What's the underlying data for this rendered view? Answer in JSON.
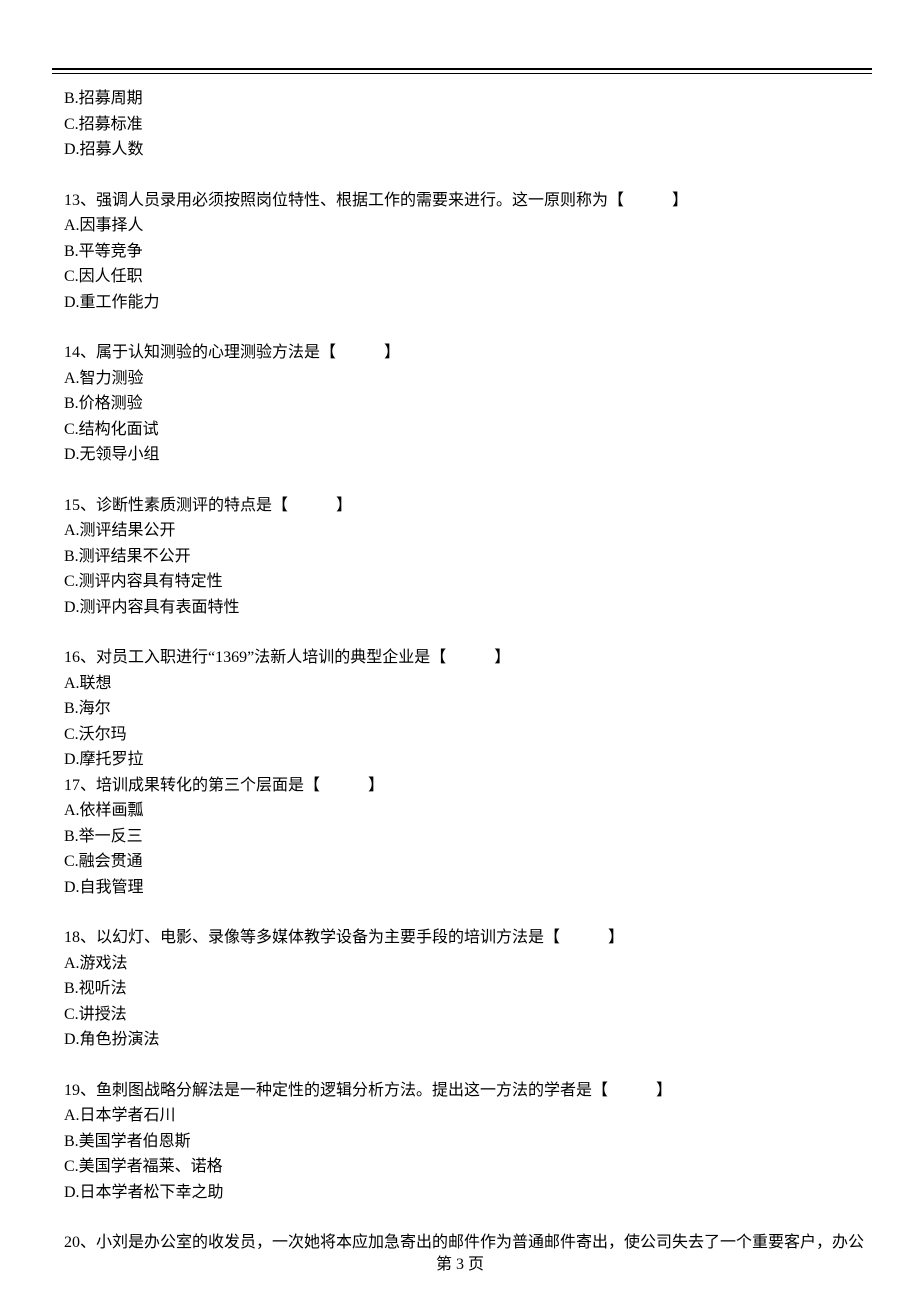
{
  "orphan_options": [
    "B.招募周期",
    "C.招募标准",
    "D.招募人数"
  ],
  "questions": [
    {
      "stem": "13、强调人员录用必须按照岗位特性、根据工作的需要来进行。这一原则称为【　　　】",
      "options": [
        "A.因事择人",
        "B.平等竞争",
        "C.因人任职",
        "D.重工作能力"
      ],
      "gap_after": true
    },
    {
      "stem": "14、属于认知测验的心理测验方法是【　　　】",
      "options": [
        "A.智力测验",
        "B.价格测验",
        "C.结构化面试",
        "D.无领导小组"
      ],
      "gap_after": true
    },
    {
      "stem": "15、诊断性素质测评的特点是【　　　】",
      "options": [
        "A.测评结果公开",
        "B.测评结果不公开",
        "C.测评内容具有特定性",
        "D.测评内容具有表面特性"
      ],
      "gap_after": true
    },
    {
      "stem": "16、对员工入职进行“1369”法新人培训的典型企业是【　　　】",
      "options": [
        "A.联想",
        "B.海尔",
        "C.沃尔玛",
        "D.摩托罗拉"
      ],
      "gap_after": false
    },
    {
      "stem": "17、培训成果转化的第三个层面是【　　　】",
      "options": [
        "A.依样画瓢",
        "B.举一反三",
        "C.融会贯通",
        "D.自我管理"
      ],
      "gap_after": true
    },
    {
      "stem": "18、以幻灯、电影、录像等多媒体教学设备为主要手段的培训方法是【　　　】",
      "options": [
        "A.游戏法",
        "B.视听法",
        "C.讲授法",
        "D.角色扮演法"
      ],
      "gap_after": true
    },
    {
      "stem": "19、鱼刺图战略分解法是一种定性的逻辑分析方法。提出这一方法的学者是【　　　】",
      "options": [
        "A.日本学者石川",
        "B.美国学者伯恩斯",
        "C.美国学者福莱、诺格",
        "D.日本学者松下幸之助"
      ],
      "gap_after": true
    },
    {
      "stem": "20、小刘是办公室的收发员，一次她将本应加急寄出的邮件作为普通邮件寄出，使公司失去了一个重要客户，办公",
      "options": [],
      "gap_after": true
    }
  ],
  "footer": "第 3 页"
}
